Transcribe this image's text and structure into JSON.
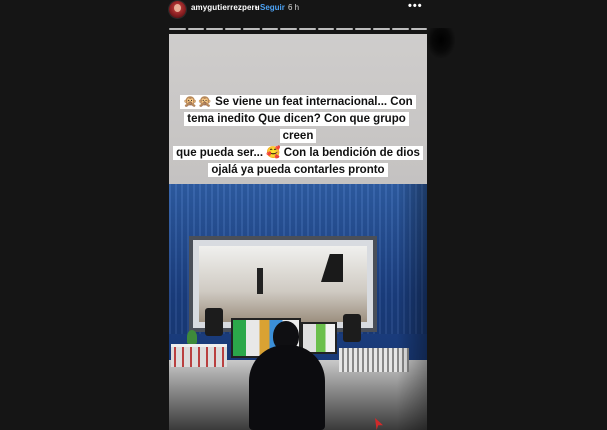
{
  "header": {
    "username": "amygutierrezperu",
    "separator": "•",
    "follow_label": "Seguir",
    "time": "6 h",
    "more_icon": "more-horizontal-icon",
    "more_glyph": "•••"
  },
  "progress": {
    "segments": 14
  },
  "story": {
    "caption_lines": [
      "🙊🙊 Se viene un feat internacional... Con",
      "tema inedito Que dicen?  Con que grupo creen",
      "que pueda ser... 🥰 Con la bendición de dios",
      "ojalá ya pueda contarles pronto"
    ]
  },
  "colors": {
    "follow": "#4da3f5",
    "background": "#151515"
  }
}
